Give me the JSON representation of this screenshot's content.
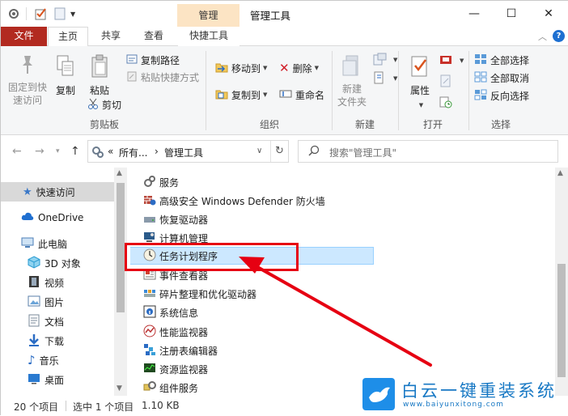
{
  "window": {
    "title": "管理工具",
    "context_tab_title": "管理",
    "controls": {
      "minimize": "—",
      "maximize": "☐",
      "close": "✕"
    }
  },
  "tabs": {
    "file": "文件",
    "home": "主页",
    "share": "共享",
    "view": "查看",
    "tools": "快捷工具",
    "help": "?"
  },
  "ribbon": {
    "clipboard": {
      "label": "剪贴板",
      "pin_line1": "固定到快",
      "pin_line2": "速访问",
      "copy": "复制",
      "paste": "粘贴",
      "copy_path": "复制路径",
      "paste_shortcut": "粘贴快捷方式",
      "cut": "剪切"
    },
    "organize": {
      "label": "组织",
      "move_to": "移动到",
      "copy_to": "复制到",
      "delete": "删除",
      "rename": "重命名"
    },
    "new": {
      "label": "新建",
      "new_folder_line1": "新建",
      "new_folder_line2": "文件夹"
    },
    "open": {
      "label": "打开",
      "properties": "属性"
    },
    "select": {
      "label": "选择",
      "select_all": "全部选择",
      "select_none": "全部取消",
      "invert": "反向选择"
    }
  },
  "address": {
    "prefix": "«",
    "all": "所有...",
    "sep": "›",
    "current": "管理工具",
    "search_placeholder": "搜索\"管理工具\""
  },
  "navpane": {
    "items": [
      {
        "label": "快速访问",
        "icon": "star-icon"
      },
      {
        "label": "OneDrive",
        "icon": "cloud-icon"
      },
      {
        "label": "此电脑",
        "icon": "computer-icon"
      },
      {
        "label": "3D 对象",
        "icon": "cube-icon"
      },
      {
        "label": "视频",
        "icon": "video-icon"
      },
      {
        "label": "图片",
        "icon": "picture-icon"
      },
      {
        "label": "文档",
        "icon": "document-icon"
      },
      {
        "label": "下载",
        "icon": "download-icon"
      },
      {
        "label": "音乐",
        "icon": "music-icon"
      },
      {
        "label": "桌面",
        "icon": "desktop-icon"
      }
    ]
  },
  "files": {
    "items": [
      {
        "label": "服务",
        "icon": "services-icon"
      },
      {
        "label": "高级安全 Windows Defender 防火墙",
        "icon": "firewall-icon"
      },
      {
        "label": "恢复驱动器",
        "icon": "recovery-drive-icon"
      },
      {
        "label": "计算机管理",
        "icon": "computer-management-icon"
      },
      {
        "label": "任务计划程序",
        "icon": "task-scheduler-icon"
      },
      {
        "label": "事件查看器",
        "icon": "event-viewer-icon"
      },
      {
        "label": "碎片整理和优化驱动器",
        "icon": "defrag-icon"
      },
      {
        "label": "系统信息",
        "icon": "system-info-icon"
      },
      {
        "label": "性能监视器",
        "icon": "performance-monitor-icon"
      },
      {
        "label": "注册表编辑器",
        "icon": "registry-editor-icon"
      },
      {
        "label": "资源监视器",
        "icon": "resource-monitor-icon"
      },
      {
        "label": "组件服务",
        "icon": "component-services-icon"
      }
    ],
    "selected_index": 4
  },
  "status": {
    "count": "20 个项目",
    "selection": "选中 1 个项目",
    "size": "1.10 KB"
  },
  "watermark": {
    "brand": "白云一键重装系统",
    "url": "www.baiyunxitong.com"
  },
  "colors": {
    "file_tab": "#b22a20",
    "context_tab": "#fce4c4",
    "selection": "#cce8ff",
    "highlight": "#e60012",
    "watermark": "#1778c4"
  }
}
